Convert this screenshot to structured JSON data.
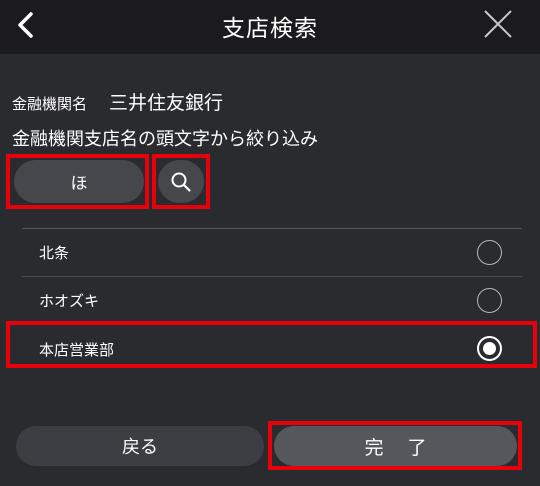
{
  "header": {
    "title": "支店検索",
    "back_icon": "chevron-left-icon",
    "close_icon": "close-icon"
  },
  "bank": {
    "label": "金融機関名",
    "name": "三井住友銀行"
  },
  "filter": {
    "label": "金融機関支店名の頭文字から絞り込み",
    "initial_value": "ほ",
    "search_icon": "search-icon"
  },
  "branches": [
    {
      "name": "北条",
      "selected": false
    },
    {
      "name": "ホオズキ",
      "selected": false
    },
    {
      "name": "本店営業部",
      "selected": true
    }
  ],
  "footer": {
    "back_label": "戻る",
    "done_label": "完了"
  },
  "colors": {
    "background": "#2a2b2f",
    "header": "#1b1b1d",
    "highlight": "#e8000b",
    "button": "#46474c"
  }
}
